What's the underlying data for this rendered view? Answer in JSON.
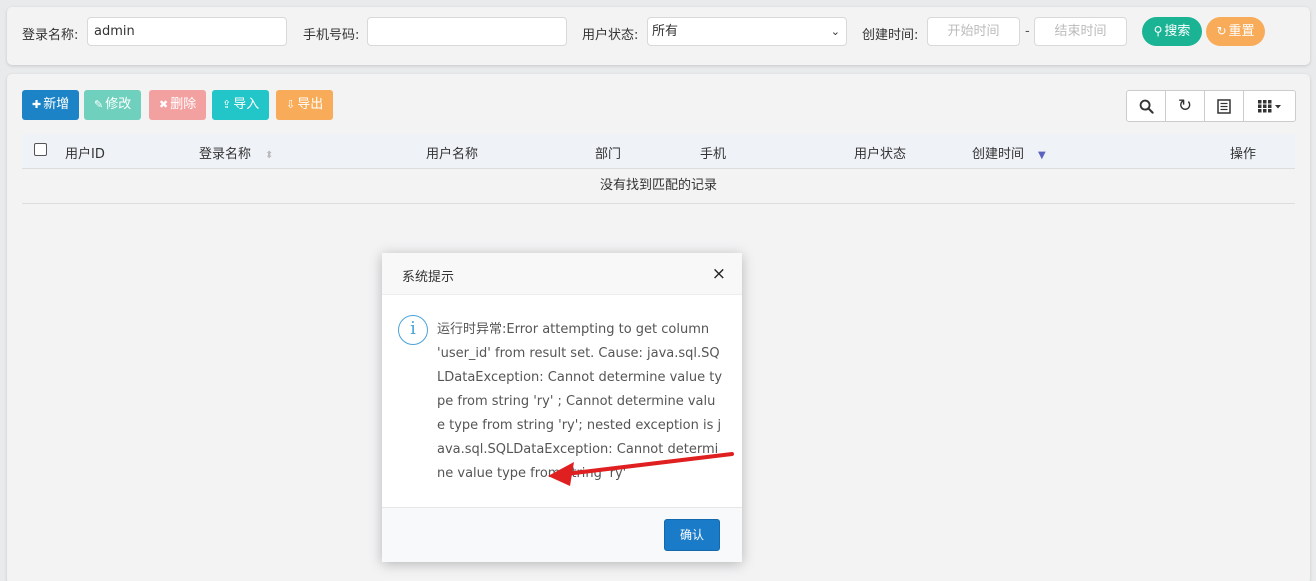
{
  "search": {
    "login_name_label": "登录名称:",
    "login_name_value": "admin",
    "phone_label": "手机号码:",
    "phone_value": "",
    "status_label": "用户状态:",
    "status_value": "所有",
    "created_label": "创建时间:",
    "start_placeholder": "开始时间",
    "dash": "-",
    "end_placeholder": "结束时间",
    "search_button": "搜索",
    "reset_button": "重置"
  },
  "toolbar": {
    "add": "新增",
    "edit": "修改",
    "delete": "删除",
    "import": "导入",
    "export": "导出"
  },
  "table": {
    "columns": [
      "用户ID",
      "登录名称",
      "用户名称",
      "部门",
      "手机",
      "用户状态",
      "创建时间",
      "操作"
    ],
    "empty_message": "没有找到匹配的记录"
  },
  "dialog": {
    "title": "系统提示",
    "close": "×",
    "info_glyph": "i",
    "message": "运行时异常:Error attempting to get column 'user_id' from result set. Cause: java.sql.SQLDataException: Cannot determine value type from string 'ry' ; Cannot determine value type from string 'ry'; nested exception is java.sql.SQLDataException: Cannot determine value type from string 'ry'",
    "confirm": "确认"
  },
  "icons": {
    "search": "search-icon",
    "refresh": "refresh-icon",
    "toggle_view": "list-view-icon",
    "columns": "columns-grid-icon",
    "info": "info-icon",
    "annotation": "red-arrow-annotation"
  },
  "colors": {
    "search_btn": "#1ab394",
    "reset_btn": "#f8ac59",
    "add_btn": "#1c84c6",
    "edit_btn": "#6fd1bd",
    "delete_btn": "#f3a0a0",
    "import_btn": "#23c6c8",
    "export_btn": "#f8ac59",
    "confirm_btn": "#1a7bc9",
    "arrow": "#e02020"
  }
}
